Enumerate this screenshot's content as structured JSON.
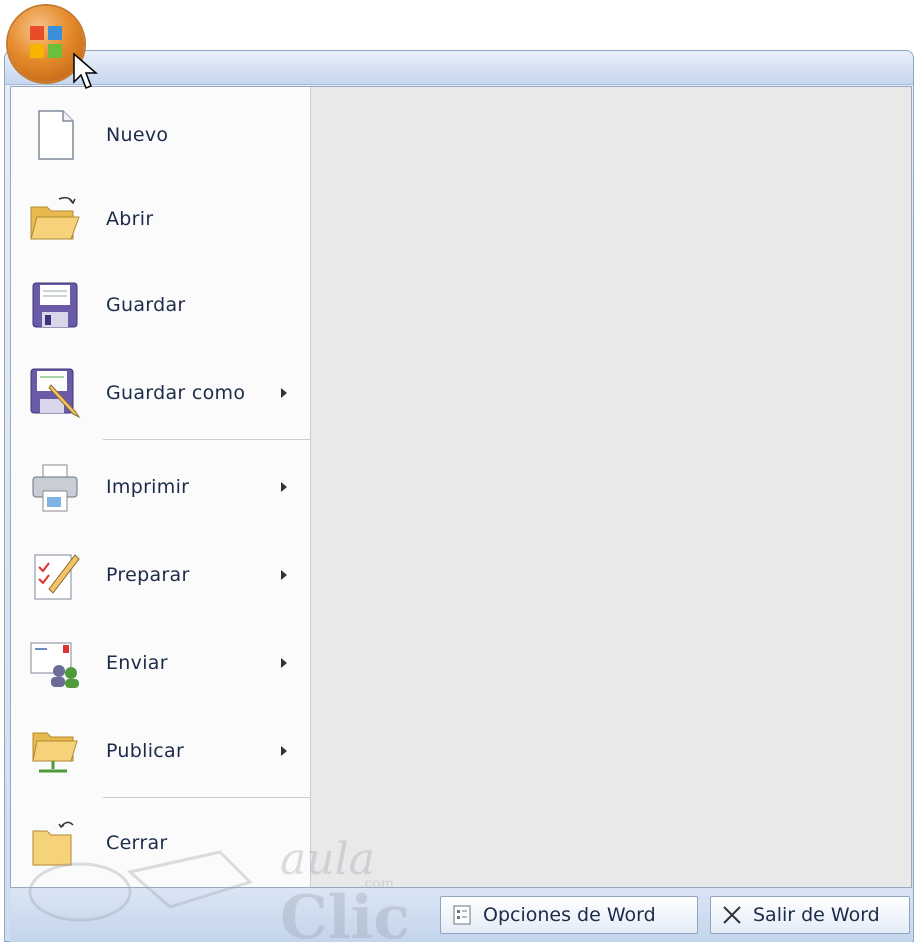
{
  "menu": {
    "items": [
      {
        "label": "Nuevo",
        "icon": "new-document-icon",
        "submenu": false
      },
      {
        "label": "Abrir",
        "icon": "open-folder-icon",
        "submenu": false
      },
      {
        "label": "Guardar",
        "icon": "save-disk-icon",
        "submenu": false
      },
      {
        "label": "Guardar como",
        "icon": "save-as-icon",
        "submenu": true
      },
      {
        "label": "Imprimir",
        "icon": "printer-icon",
        "submenu": true
      },
      {
        "label": "Preparar",
        "icon": "prepare-document-icon",
        "submenu": true
      },
      {
        "label": "Enviar",
        "icon": "send-email-icon",
        "submenu": true
      },
      {
        "label": "Publicar",
        "icon": "publish-folder-icon",
        "submenu": true
      },
      {
        "label": "Cerrar",
        "icon": "close-folder-icon",
        "submenu": false
      }
    ]
  },
  "footer": {
    "options_label": "Opciones de Word",
    "exit_label": "Salir de Word"
  },
  "watermark": {
    "line1": "aula",
    "line2": "Clic",
    "suffix": ".com"
  },
  "colors": {
    "office_button": "#e58b2b",
    "menu_bg": "#fbfbfb",
    "panel_bg": "#e9e9ea",
    "text": "#1d2b4a"
  }
}
